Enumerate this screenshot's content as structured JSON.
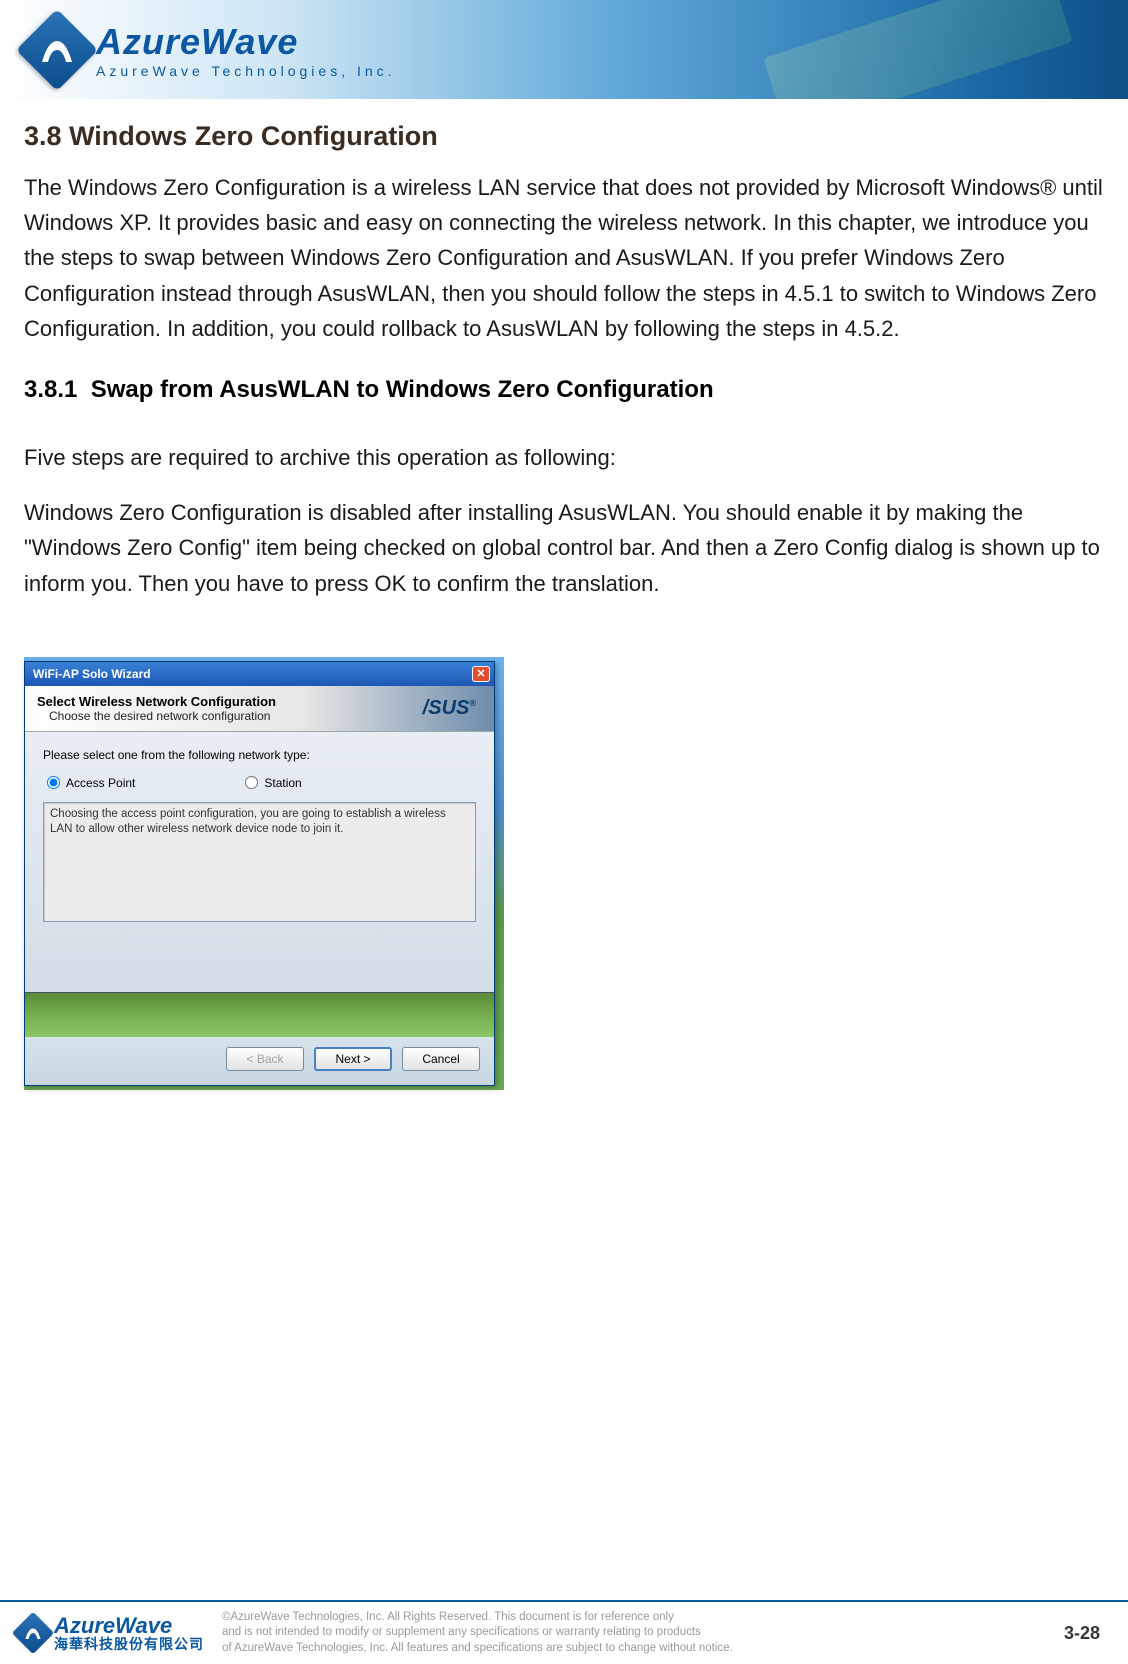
{
  "brand": {
    "name": "AzureWave",
    "tagline": "AzureWave  Technologies,  Inc.",
    "footer_cn": "海華科技股份有限公司"
  },
  "section": {
    "number": "3.8",
    "title": "Windows Zero Configuration",
    "intro": "The Windows Zero Configuration is a wireless LAN service that does not provided by Microsoft Windows® until Windows XP. It provides basic and easy on connecting the wireless network. In this chapter, we introduce you the steps to swap between Windows Zero Configuration and AsusWLAN. If you prefer Windows Zero Configuration instead through AsusWLAN, then you should follow the steps in 4.5.1 to switch to Windows Zero Configuration. In addition, you could rollback to AsusWLAN by following the steps in 4.5.2."
  },
  "subsection": {
    "number": "3.8.1",
    "title": "Swap from AsusWLAN to Windows Zero Configuration",
    "p1": "Five steps are required to archive this operation as following:",
    "p2": "Windows Zero Configuration is disabled after installing AsusWLAN. You should enable it by making the \"Windows Zero Config\" item being checked on global control bar. And then a Zero Config dialog is shown up to inform you. Then you have to press OK to confirm the translation."
  },
  "wizard": {
    "window_title": "WiFi-AP Solo Wizard",
    "header_title": "Select Wireless Network Configuration",
    "header_sub": "Choose the desired network configuration",
    "brand_badge": "/SUS",
    "prompt": "Please select one from the following network type:",
    "radios": {
      "access_point": "Access Point",
      "station": "Station"
    },
    "description": "Choosing the access point configuration, you are going to establish a wireless LAN to allow other wireless network device node to join it.",
    "buttons": {
      "back": "< Back",
      "next": "Next >",
      "cancel": "Cancel"
    }
  },
  "footer": {
    "copy_l1": "©AzureWave Technologies, Inc. All Rights Reserved. This document is for reference only",
    "copy_l2": "and is not intended to modify or supplement any specifications or  warranty relating to products",
    "copy_l3": "of AzureWave Technologies, Inc.  All features and specifications are subject to change without notice."
  },
  "page_number": "3-28"
}
